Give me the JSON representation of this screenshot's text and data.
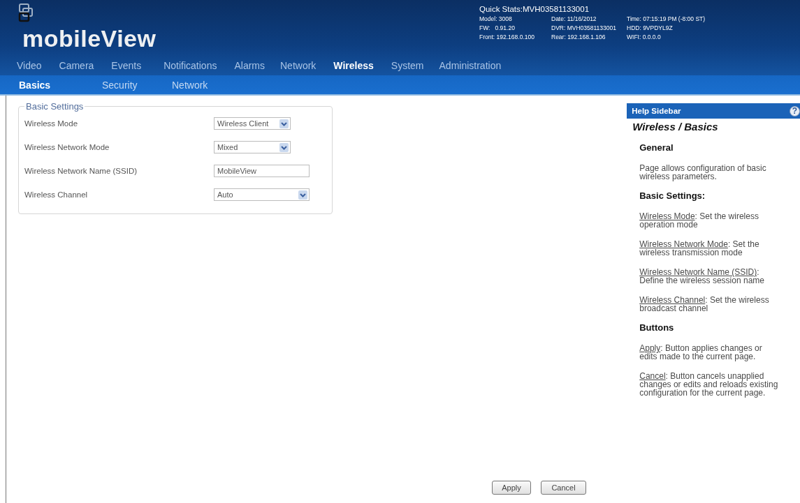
{
  "logo": {
    "text": "mobileView"
  },
  "quick_stats": {
    "title": "Quick Stats:MVH03581133001",
    "rows": [
      [
        "Model: 3008",
        "Date: 11/16/2012",
        "Time: 07:15:19 PM (-8:00 ST)"
      ],
      [
        "FW:   0.91.20",
        "DVR: MVH03581133001",
        "HDD: 9VPDYL9Z"
      ],
      [
        "Front: 192.168.0.100",
        "Rear: 192.168.1.106",
        "WIFI: 0.0.0.0"
      ]
    ]
  },
  "main_nav": [
    {
      "label": "Video",
      "selected": false
    },
    {
      "label": "Camera",
      "selected": false
    },
    {
      "label": "Events",
      "selected": false
    },
    {
      "label": "Notifications",
      "selected": false
    },
    {
      "label": "Alarms",
      "selected": false
    },
    {
      "label": "Network",
      "selected": false
    },
    {
      "label": "Wireless",
      "selected": true
    },
    {
      "label": "System",
      "selected": false
    },
    {
      "label": "Administration",
      "selected": false
    }
  ],
  "sub_nav": [
    {
      "label": "Basics",
      "selected": true
    },
    {
      "label": "Security",
      "selected": false
    },
    {
      "label": "Network",
      "selected": false
    }
  ],
  "basic_settings": {
    "legend": "Basic Settings",
    "fields": [
      {
        "label": "Wireless Mode",
        "kind": "select",
        "value": "Wireless Client"
      },
      {
        "label": "Wireless Network Mode",
        "kind": "select",
        "value": "Mixed"
      },
      {
        "label": "Wireless Network Name (SSID)",
        "kind": "text",
        "value": "MobileView"
      },
      {
        "label": "Wireless Channel",
        "kind": "select",
        "value": "Auto"
      }
    ]
  },
  "buttons": [
    "Apply",
    "Cancel"
  ],
  "help_sidebar": {
    "title": "Help Sidebar",
    "help_icon": "?",
    "heading": "Wireless / Basics",
    "sections": [
      {
        "heading": "General",
        "items": [
          {
            "text": "Page allows configuration of basic wireless parameters."
          }
        ]
      },
      {
        "heading": "Basic Settings:",
        "items": [
          {
            "link": "Wireless Mode",
            "text": ": Set the wireless operation mode"
          },
          {
            "link": "Wireless Network Mode",
            "text": ": Set the wireless transmission mode"
          },
          {
            "link": "Wireless Network Name (SSID)",
            "text": ": Define the wireless session name"
          },
          {
            "link": "Wireless Channel",
            "text": ": Set the wireless broadcast channel"
          }
        ]
      },
      {
        "heading": "Buttons",
        "items": [
          {
            "link": "Apply",
            "text": ": Button applies changes or edits made to the current page."
          },
          {
            "link": "Cancel",
            "text": ": Button cancels unapplied changes or edits and reloads existing configuration for the current page."
          }
        ]
      }
    ]
  }
}
